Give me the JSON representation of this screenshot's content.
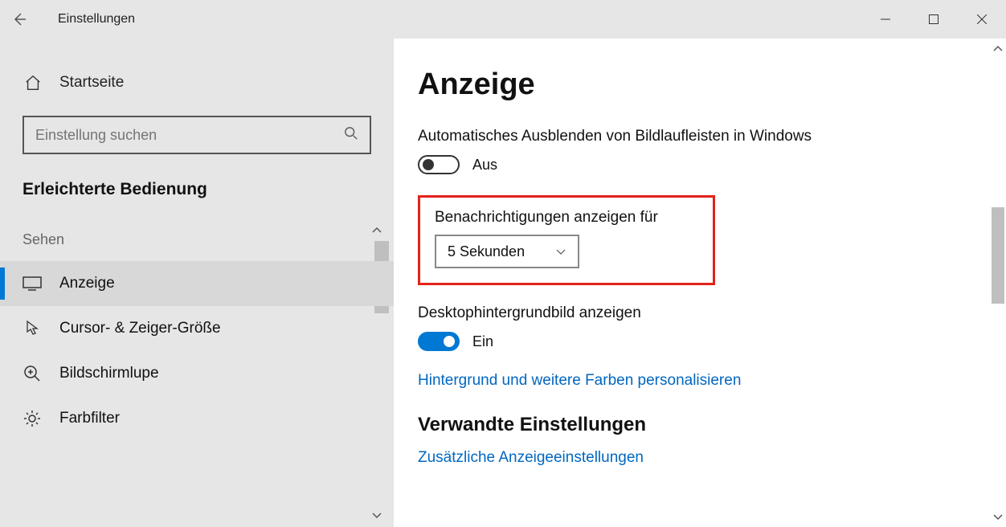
{
  "titlebar": {
    "title": "Einstellungen"
  },
  "sidebar": {
    "home": "Startseite",
    "search_placeholder": "Einstellung suchen",
    "section": "Erleichterte Bedienung",
    "category": "Sehen",
    "items": [
      {
        "label": "Anzeige"
      },
      {
        "label": "Cursor- & Zeiger-Größe"
      },
      {
        "label": "Bildschirmlupe"
      },
      {
        "label": "Farbfilter"
      }
    ]
  },
  "main": {
    "heading": "Anzeige",
    "auto_hide_label": "Automatisches Ausblenden von Bildlaufleisten in Windows",
    "auto_hide_state": "Aus",
    "notify_label": "Benachrichtigungen anzeigen für",
    "notify_value": "5 Sekunden",
    "desktop_bg_label": "Desktophintergrundbild anzeigen",
    "desktop_bg_state": "Ein",
    "personalize_link": "Hintergrund und weitere Farben personalisieren",
    "related_heading": "Verwandte Einstellungen",
    "related_link": "Zusätzliche Anzeigeeinstellungen"
  }
}
